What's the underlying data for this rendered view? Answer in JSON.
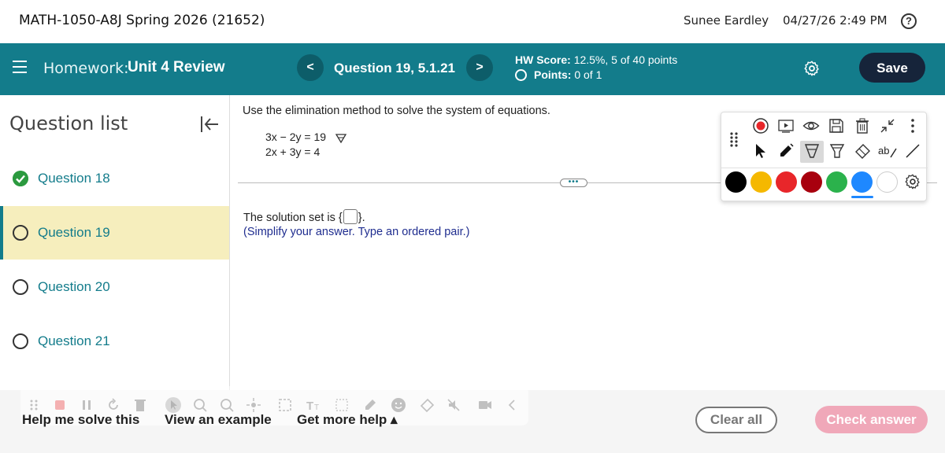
{
  "topbar": {
    "course_title": "MATH-1050-A8J Spring 2026 (21652)",
    "user_name": "Sunee Eardley",
    "datetime": "04/27/26 2:49 PM",
    "help_icon": "question-circle-icon"
  },
  "header": {
    "homework_label": "Homework:",
    "homework_name": "Unit 4 Review",
    "question_label": "Question 19, 5.1.21",
    "prev_icon": "<",
    "next_icon": ">",
    "hw_score_label": "HW Score:",
    "hw_score_value": "12.5%, 5 of 40 points",
    "points_label": "Points:",
    "points_value": "0 of 1",
    "save_label": "Save",
    "accent_color": "#137c8b"
  },
  "sidebar": {
    "title": "Question list",
    "items": [
      {
        "label": "Question 18",
        "status": "complete"
      },
      {
        "label": "Question 19",
        "status": "current"
      },
      {
        "label": "Question 20",
        "status": "not-started"
      },
      {
        "label": "Question 21",
        "status": "not-started"
      }
    ]
  },
  "question": {
    "prompt": "Use the elimination method to solve the system of equations.",
    "equations": [
      "3x − 2y = 19",
      "2x + 3y = 4"
    ],
    "solution_prefix": "The solution set is {",
    "solution_suffix": "}.",
    "hint": "(Simplify your answer. Type an ordered pair.)"
  },
  "draw_toolbar": {
    "colors": [
      "#000000",
      "#f5b800",
      "#e8262a",
      "#a8000e",
      "#2bb24c",
      "#1e88ff",
      "#ffffff"
    ],
    "selected_color": "#1e88ff"
  },
  "bottom": {
    "help_solve": "Help me solve this",
    "view_example": "View an example",
    "get_help": "Get more help ▴",
    "clear_all": "Clear all",
    "check_answer": "Check answer"
  }
}
